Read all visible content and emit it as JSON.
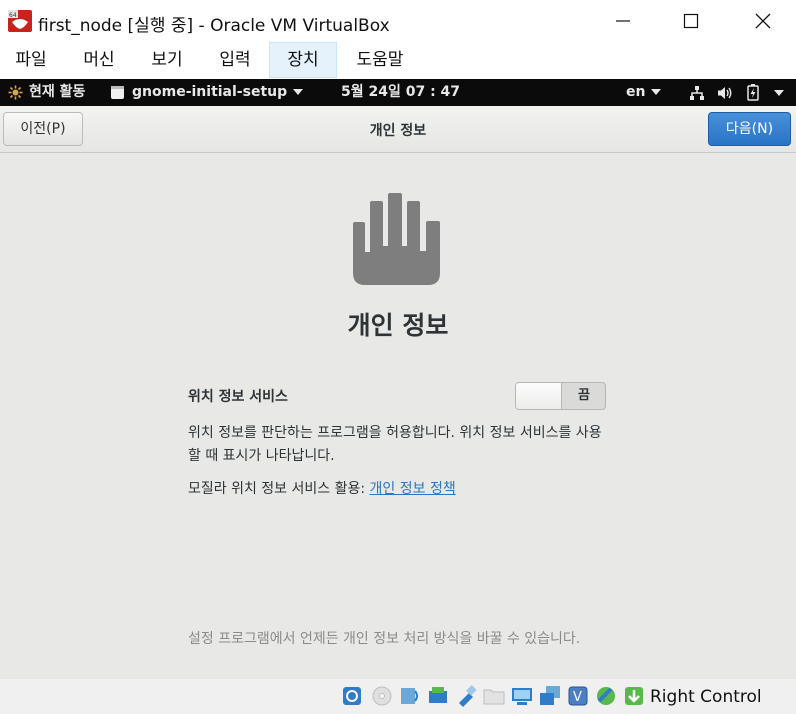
{
  "window": {
    "title": "first_node [실행 중] - Oracle VM VirtualBox",
    "app_icon": "virtualbox-icon",
    "controls": [
      "minimize-icon",
      "maximize-icon",
      "close-icon"
    ]
  },
  "menu": {
    "items": [
      {
        "label": "파일"
      },
      {
        "label": "머신"
      },
      {
        "label": "보기"
      },
      {
        "label": "입력"
      },
      {
        "label": "장치",
        "active": true
      },
      {
        "label": "도움말"
      }
    ]
  },
  "gnome_bar": {
    "activities": "현재 활동",
    "app_menu": "gnome-initial-setup",
    "clock": "5월 24일  07 : 47",
    "input_source": "en",
    "status_icons": [
      "network-icon",
      "volume-icon",
      "battery-icon",
      "system-menu-arrow-icon"
    ]
  },
  "header": {
    "prev_label": "이전(P)",
    "title": "개인 정보",
    "next_label": "다음(N)"
  },
  "content": {
    "hero_icon": "hand-privacy-icon",
    "heading": "개인 정보",
    "location_label": "위치 정보 서비스",
    "switch_state": "끔",
    "switch_on": false,
    "description": "위치 정보를 판단하는 프로그램을 허용합니다. 위치 정보 서비스를 사용할 때 표시가 나타납니다.",
    "mozilla_prefix": "모질라 위치 정보 서비스 활용: ",
    "policy_link": "개인 정보 정책",
    "footnote": "설정 프로그램에서 언제든 개인 정보 처리 방식을 바꿀 수 있습니다."
  },
  "statusbar": {
    "icons": [
      "hard-disk-icon",
      "optical-drive-icon",
      "audio-icon",
      "network-adapter-icon",
      "usb-icon",
      "shared-folders-icon",
      "display-icon",
      "recording-icon",
      "cpu-icon",
      "guest-additions-icon",
      "mouse-integration-icon"
    ],
    "host_key": "Right Control"
  },
  "colors": {
    "accent": "#2a74c6",
    "link": "#2a76c6",
    "content_bg": "#e8e8e7",
    "topbar_bg": "#0b0b0b"
  }
}
